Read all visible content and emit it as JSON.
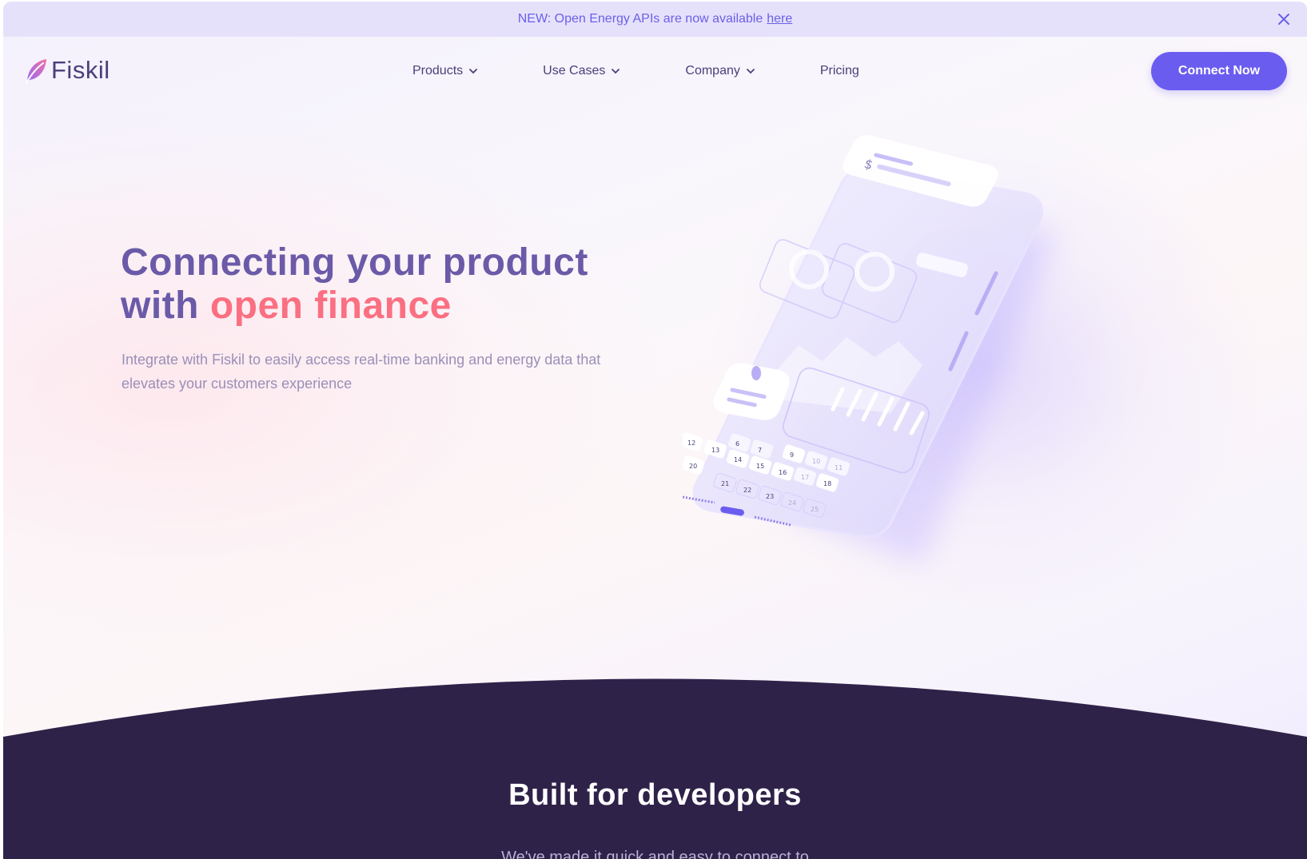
{
  "announcement": {
    "text": "NEW: Open Energy APIs are now available",
    "link_label": "here"
  },
  "header": {
    "logo_text": "Fiskil",
    "nav": [
      {
        "label": "Products",
        "has_dropdown": true
      },
      {
        "label": "Use Cases",
        "has_dropdown": true
      },
      {
        "label": "Company",
        "has_dropdown": true
      },
      {
        "label": "Pricing",
        "has_dropdown": false
      }
    ],
    "cta_label": "Connect Now"
  },
  "hero": {
    "title_line1": "Connecting your product",
    "title_line2_prefix": "with ",
    "title_accent": "open finance",
    "subtitle_line1": "Integrate with Fiskil to easily access real-time banking and energy data that",
    "subtitle_line2": "elevates your customers experience"
  },
  "phone": {
    "calendar_numbers": [
      "12",
      "13",
      "6",
      "7",
      "14",
      "15",
      "16",
      "9",
      "10",
      "11",
      "19",
      "20",
      "17",
      "18",
      "21",
      "22",
      "23",
      "24",
      "25"
    ],
    "currency_glyph": "$"
  },
  "developers": {
    "title": "Built for developers",
    "subtitle": "We've made it quick and easy to connect to"
  },
  "colors": {
    "brand": "#6b5cf0",
    "heading": "#6a5aa8",
    "accent": "#fb6f82",
    "dark_bg": "#2f2249"
  },
  "icons": {
    "close": "close-icon",
    "chevron": "chevron-down-icon",
    "logo": "leaf-logo-icon"
  }
}
